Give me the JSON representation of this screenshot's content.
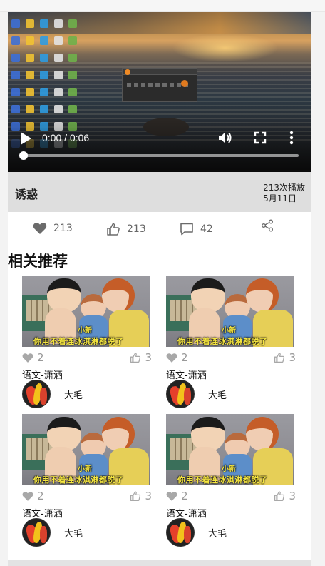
{
  "video": {
    "time_display": "0:00 / 0:06",
    "progress_fraction": 0.0,
    "controls": [
      "play-icon",
      "volume-icon",
      "fullscreen-icon",
      "more-vertical-icon"
    ]
  },
  "post": {
    "title": "诱惑",
    "play_count": "213次播放",
    "date": "5月11日"
  },
  "actions": {
    "likes": "213",
    "thumbs_up": "213",
    "comments": "42",
    "share_icon": "share-icon"
  },
  "related": {
    "heading": "相关推荐",
    "items": [
      {
        "likes": "2",
        "thumbs_up": "3",
        "title": "语文-潇洒",
        "author": "大毛",
        "caption_top": "小新",
        "caption_bottom": "你用不着连冰淇淋都脱了"
      },
      {
        "likes": "2",
        "thumbs_up": "3",
        "title": "语文-潇洒",
        "author": "大毛",
        "caption_top": "小新",
        "caption_bottom": "你用不着连冰淇淋都脱了"
      },
      {
        "likes": "2",
        "thumbs_up": "3",
        "title": "语文-潇洒",
        "author": "大毛",
        "caption_top": "小新",
        "caption_bottom": "你用不着连冰淇淋都脱了"
      },
      {
        "likes": "2",
        "thumbs_up": "3",
        "title": "语文-潇洒",
        "author": "大毛",
        "caption_top": "小新",
        "caption_bottom": "你用不着连冰淇淋都脱了"
      }
    ]
  },
  "colors": {
    "page_bg": "#f3f3f3",
    "title_bar_bg": "#dedede",
    "icon_grey": "#666666",
    "stat_grey": "#999999",
    "subtitle_yellow": "#f5e640"
  }
}
